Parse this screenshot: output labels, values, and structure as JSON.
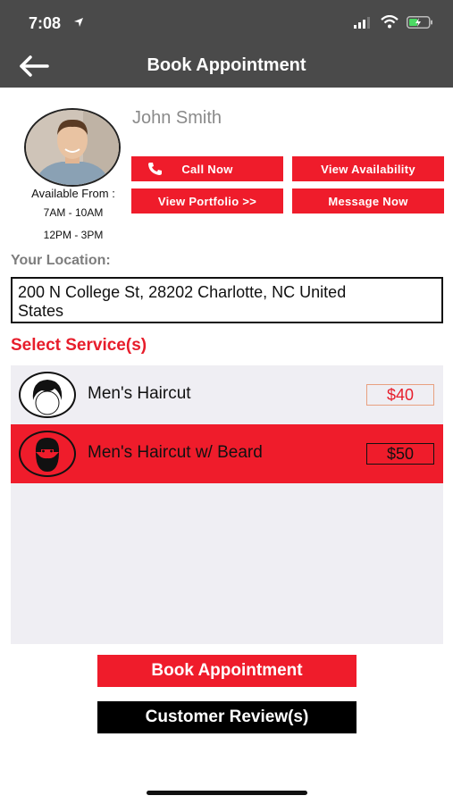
{
  "status_bar": {
    "time": "7:08"
  },
  "nav": {
    "title": "Book Appointment"
  },
  "profile": {
    "name": "John Smith",
    "available_label": "Available From :",
    "slots": [
      "7AM - 10AM",
      "12PM - 3PM"
    ]
  },
  "actions": {
    "call": "Call Now",
    "availability": "View Availability",
    "portfolio": "View Portfolio >>",
    "message": "Message Now"
  },
  "location": {
    "label": "Your Location:",
    "value_line1": "200 N College St, 28202 Charlotte, NC United",
    "value_line2": "States"
  },
  "services": {
    "label": "Select Service(s)",
    "items": [
      {
        "name": "Men's Haircut",
        "price": "$40",
        "selected": false
      },
      {
        "name": "Men's Haircut w/ Beard",
        "price": "$50",
        "selected": true
      }
    ]
  },
  "buttons": {
    "book": "Book Appointment",
    "reviews": "Customer Review(s)"
  },
  "colors": {
    "accent": "#ef1c2b",
    "bar": "#4a4a4a",
    "panel": "#efeef3",
    "dark": "#000000"
  }
}
